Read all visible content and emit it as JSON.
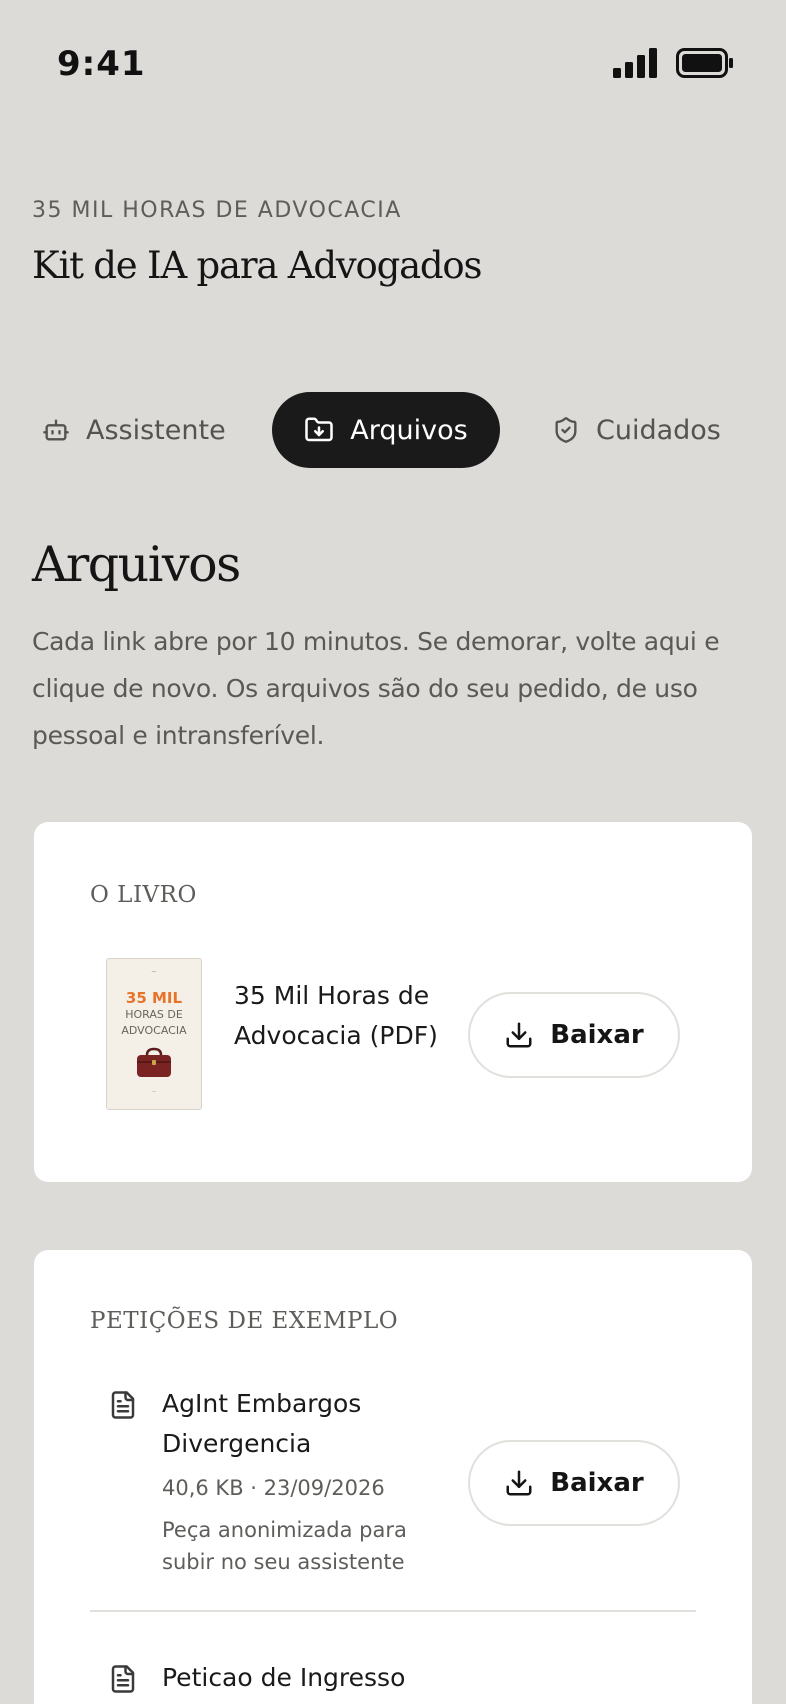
{
  "status": {
    "time": "9:41"
  },
  "header": {
    "eyebrow": "35 MIL HORAS DE ADVOCACIA",
    "title": "Kit de IA para Advogados"
  },
  "tabs": [
    {
      "label": "Assistente",
      "icon": "robot-icon",
      "active": false
    },
    {
      "label": "Arquivos",
      "icon": "folder-download-icon",
      "active": true
    },
    {
      "label": "Cuidados",
      "icon": "shield-check-icon",
      "active": false
    }
  ],
  "section": {
    "title": "Arquivos",
    "description": "Cada link abre por 10 minutos. Se demorar, volte aqui e clique de novo. Os arquivos são do seu pedido, de uso pessoal e intransferível."
  },
  "book_card": {
    "label": "O LIVRO",
    "cover": {
      "line1": "35 MIL",
      "line2": "HORAS DE",
      "line3": "ADVOCACIA"
    },
    "title": "35 Mil Horas de Advocacia (PDF)",
    "button_label": "Baixar"
  },
  "petitions_card": {
    "label": "PETIÇÕES DE EXEMPLO",
    "items": [
      {
        "name": "AgInt Embargos Divergencia",
        "meta": "40,6 KB · 23/09/2026",
        "note": "Peça anonimizada para subir no seu assistente",
        "button_label": "Baixar"
      },
      {
        "name": "Peticao de Ingresso como Amicus"
      }
    ]
  },
  "colors": {
    "background": "#dcdbd8",
    "card": "#ffffff",
    "active_tab": "#1a1a1a",
    "cover_accent": "#e8742a"
  }
}
